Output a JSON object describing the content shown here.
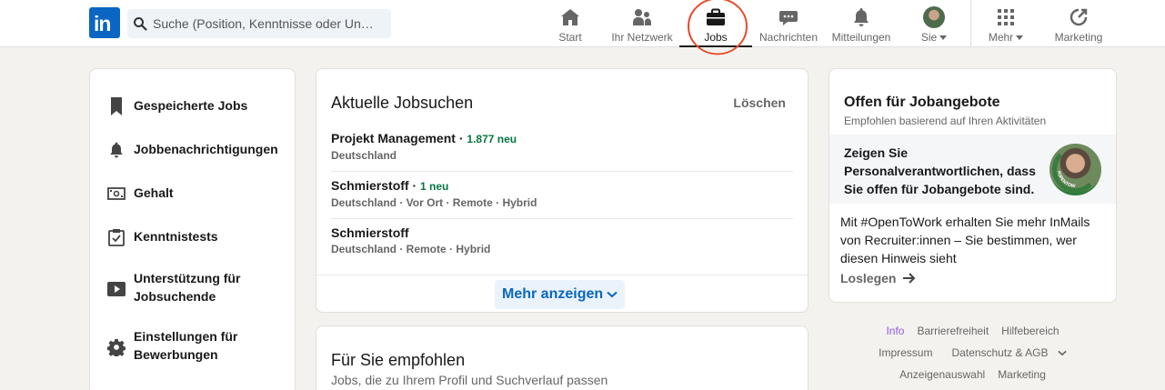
{
  "nav": {
    "logo_text": "in",
    "search_placeholder": "Suche (Position, Kenntnisse oder Un…",
    "items": [
      {
        "label": "Start",
        "icon": "home-icon"
      },
      {
        "label": "Ihr Netzwerk",
        "icon": "network-icon"
      },
      {
        "label": "Jobs",
        "icon": "briefcase-icon",
        "active": true
      },
      {
        "label": "Nachrichten",
        "icon": "messaging-icon"
      },
      {
        "label": "Mitteilungen",
        "icon": "bell-icon"
      },
      {
        "label": "Sie",
        "icon": "avatar"
      },
      {
        "label": "Mehr",
        "icon": "grid-icon"
      },
      {
        "label": "Marketing",
        "icon": "marketing-icon"
      }
    ]
  },
  "sidebar": {
    "items": [
      {
        "label": "Gespeicherte Jobs",
        "icon": "bookmark-icon"
      },
      {
        "label": "Jobbenachrichtigungen",
        "icon": "bell-icon"
      },
      {
        "label": "Gehalt",
        "icon": "money-icon"
      },
      {
        "label": "Kenntnistests",
        "icon": "clipboard-check-icon"
      },
      {
        "label": "Unterstützung für Jobsuchende",
        "icon": "video-icon"
      },
      {
        "label": "Einstellungen für Bewerbungen",
        "icon": "gear-icon"
      }
    ]
  },
  "recent_searches": {
    "title": "Aktuelle Jobsuchen",
    "clear_label": "Löschen",
    "items": [
      {
        "title": "Projekt Management",
        "new_count": "1.877 neu",
        "subtitle": "Deutschland"
      },
      {
        "title": "Schmierstoff",
        "new_count": "1 neu",
        "subtitle": "Deutschland · Vor Ort · Remote · Hybrid"
      },
      {
        "title": "Schmierstoff",
        "new_count": "",
        "subtitle": "Deutschland · Remote · Hybrid"
      }
    ],
    "more_label": "Mehr anzeigen"
  },
  "recommended": {
    "title": "Für Sie empfohlen",
    "subtitle": "Jobs, die zu Ihrem Profil und Suchverlauf passen"
  },
  "open_to_work": {
    "title": "Offen für Jobangebote",
    "subtitle": "Empfohlen basierend auf Ihren Aktivitäten",
    "promo": "Zeigen Sie Personalverantwortlichen, dass Sie offen für Jobangebote sind.",
    "body": "Mit #OpenToWork erhalten Sie mehr InMails von Recruiter:innen – Sie bestimmen, wer diesen Hinweis sieht",
    "cta": "Loslegen",
    "badge_text": "#OPENTOWORK"
  },
  "footer": {
    "links": [
      "Info",
      "Barrierefreiheit",
      "Hilfebereich",
      "Impressum",
      "Datenschutz & AGB",
      "Anzeigenauswahl",
      "Marketing"
    ]
  },
  "colors": {
    "brand": "#0a66c2",
    "new_green": "#057642",
    "annotation_red": "#e84a2a"
  }
}
